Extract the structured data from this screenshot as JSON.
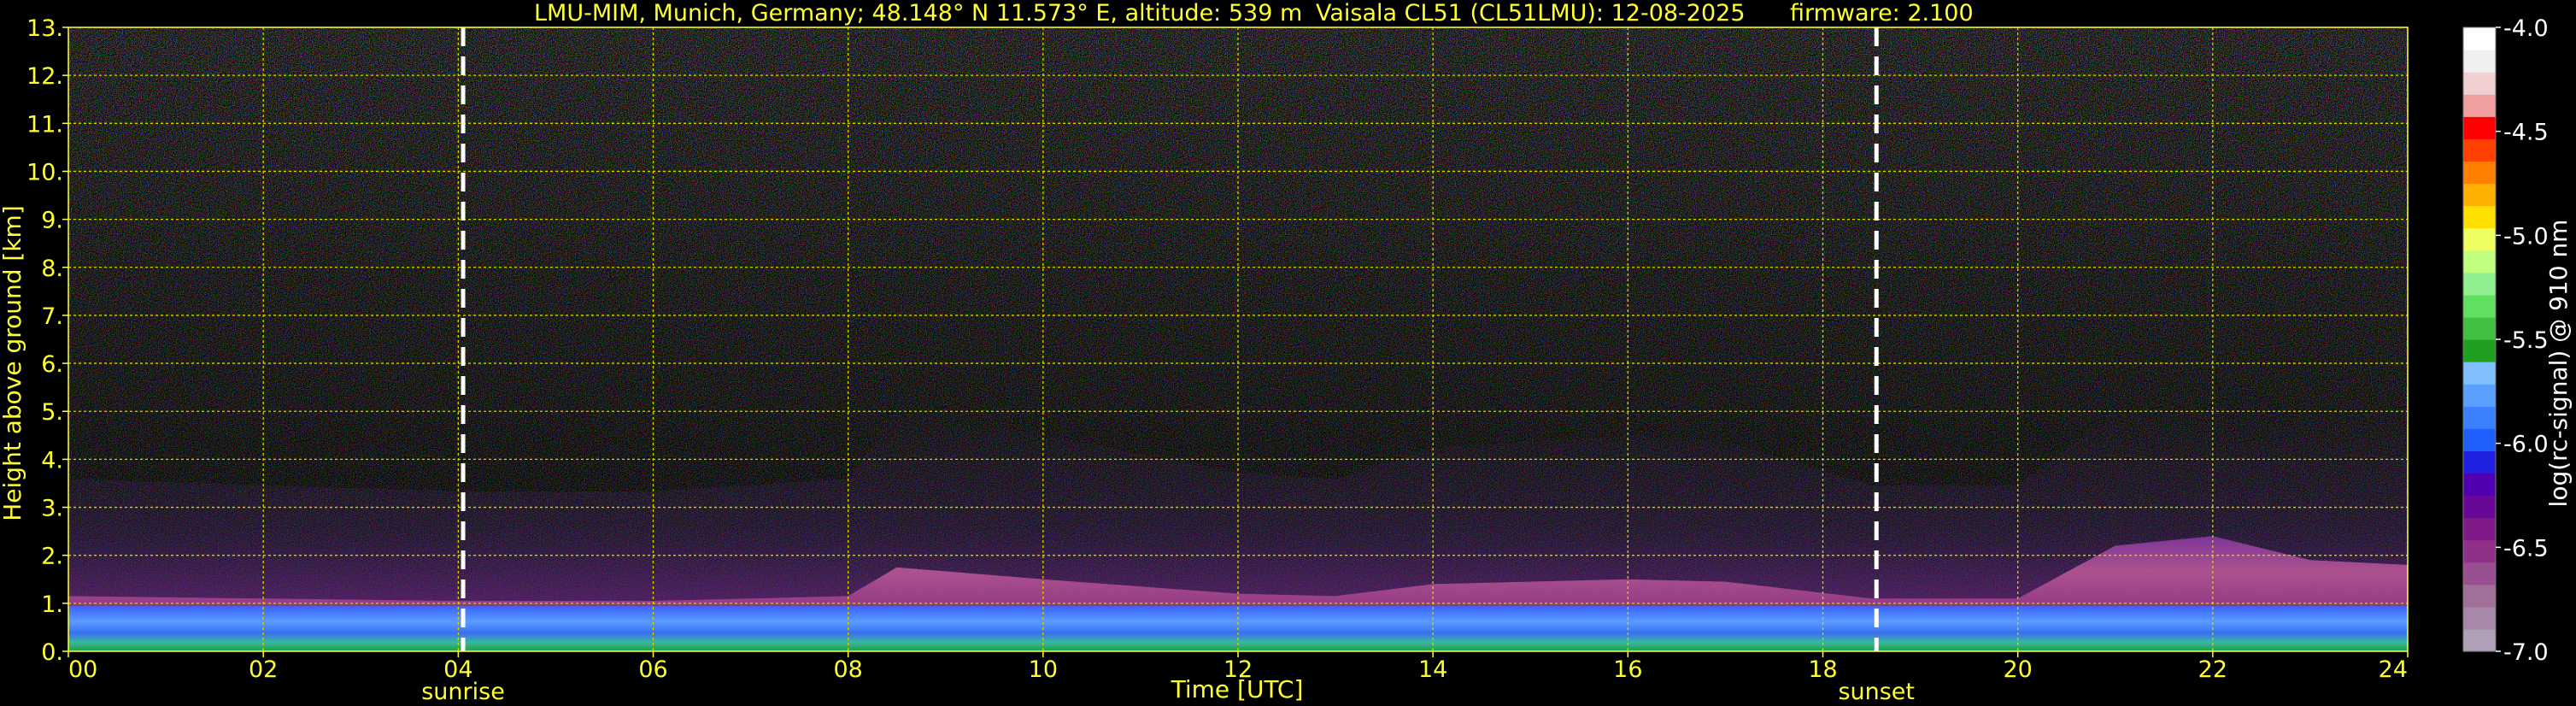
{
  "chart_data": {
    "type": "heatmap",
    "title_left": "LMU-MIM, Munich, Germany; 48.148° N 11.573° E, altitude: 539 m",
    "title_mid": "Vaisala CL51 (CL51LMU): 12-08-2025",
    "title_right": "firmware: 2.100",
    "xlabel": "Time [UTC]",
    "ylabel": "Height above ground [km]",
    "xlim": [
      0,
      24
    ],
    "ylim": [
      0,
      13
    ],
    "x_ticks": [
      {
        "v": 0,
        "label": "00"
      },
      {
        "v": 2,
        "label": "02"
      },
      {
        "v": 4,
        "label": "04"
      },
      {
        "v": 6,
        "label": "06"
      },
      {
        "v": 8,
        "label": "08"
      },
      {
        "v": 10,
        "label": "10"
      },
      {
        "v": 12,
        "label": "12"
      },
      {
        "v": 14,
        "label": "14"
      },
      {
        "v": 16,
        "label": "16"
      },
      {
        "v": 18,
        "label": "18"
      },
      {
        "v": 20,
        "label": "20"
      },
      {
        "v": 22,
        "label": "22"
      },
      {
        "v": 24,
        "label": "24"
      }
    ],
    "y_ticks": [
      {
        "v": 0,
        "label": "0."
      },
      {
        "v": 1,
        "label": "1."
      },
      {
        "v": 2,
        "label": "2."
      },
      {
        "v": 3,
        "label": "3."
      },
      {
        "v": 4,
        "label": "4."
      },
      {
        "v": 5,
        "label": "5."
      },
      {
        "v": 6,
        "label": "6."
      },
      {
        "v": 7,
        "label": "7."
      },
      {
        "v": 8,
        "label": "8."
      },
      {
        "v": 9,
        "label": "9."
      },
      {
        "v": 10,
        "label": "10."
      },
      {
        "v": 11,
        "label": "11."
      },
      {
        "v": 12,
        "label": "12."
      },
      {
        "v": 13,
        "label": "13."
      }
    ],
    "grid": true,
    "grid_color": "#d4d400",
    "markers": [
      {
        "time": 4.05,
        "label": "sunrise"
      },
      {
        "time": 18.55,
        "label": "sunset"
      }
    ],
    "boundary_layer_height": [
      [
        0,
        1.15
      ],
      [
        2,
        1.1
      ],
      [
        4,
        1.05
      ],
      [
        6,
        1.05
      ],
      [
        8,
        1.15
      ],
      [
        8.5,
        1.75
      ],
      [
        10,
        1.5
      ],
      [
        12,
        1.2
      ],
      [
        13,
        1.15
      ],
      [
        14,
        1.4
      ],
      [
        16,
        1.5
      ],
      [
        17,
        1.45
      ],
      [
        18.5,
        1.1
      ],
      [
        20,
        1.1
      ],
      [
        21,
        2.2
      ],
      [
        22,
        2.4
      ],
      [
        23,
        1.9
      ],
      [
        24,
        1.8
      ]
    ],
    "colorbar": {
      "label": "log(rc-signal) @ 910 nm",
      "min": -7.0,
      "max": -4.0,
      "ticks": [
        {
          "v": -4.0,
          "label": "-4.0"
        },
        {
          "v": -4.5,
          "label": "-4.5"
        },
        {
          "v": -5.0,
          "label": "-5.0"
        },
        {
          "v": -5.5,
          "label": "-5.5"
        },
        {
          "v": -6.0,
          "label": "-6.0"
        },
        {
          "v": -6.5,
          "label": "-6.5"
        },
        {
          "v": -7.0,
          "label": "-7.0"
        }
      ],
      "colors": [
        "#b0a0b8",
        "#a888a8",
        "#a07098",
        "#985090",
        "#903088",
        "#801888",
        "#680898",
        "#5000b0",
        "#2020e0",
        "#2060ff",
        "#3a80ff",
        "#5aa0ff",
        "#80c0ff",
        "#20a020",
        "#40c040",
        "#60e060",
        "#90f090",
        "#c0ff80",
        "#f0ff60",
        "#ffe000",
        "#ffb000",
        "#ff8000",
        "#ff4000",
        "#ff0000",
        "#f0a0a0",
        "#f0d0d0",
        "#f0f0f0",
        "#ffffff"
      ]
    }
  }
}
